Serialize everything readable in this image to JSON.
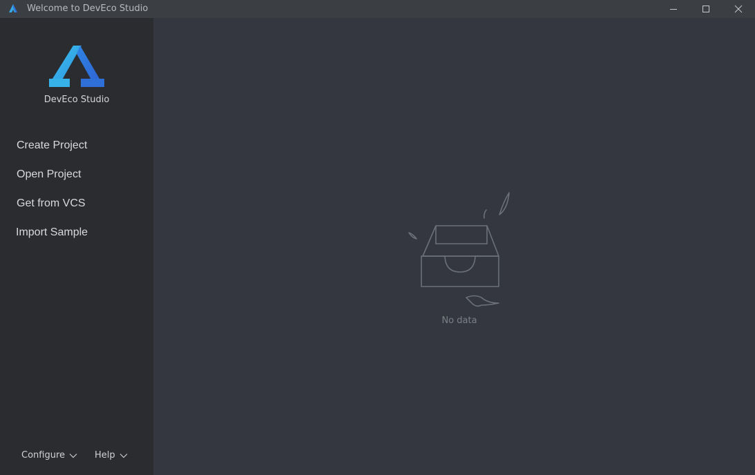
{
  "window": {
    "title": "Welcome to DevEco Studio"
  },
  "sidebar": {
    "app_name": "DevEco Studio",
    "menu": [
      {
        "label": "Create Project"
      },
      {
        "label": "Open Project"
      },
      {
        "label": "Get from VCS"
      },
      {
        "label": "Import Sample"
      }
    ],
    "footer": {
      "configure_label": "Configure",
      "help_label": "Help"
    }
  },
  "main": {
    "empty_text": "No data"
  },
  "colors": {
    "titlebar": "#3b3e43",
    "sidebar": "#2a2c30",
    "main": "#343740",
    "logo_light": "#38b6e8",
    "logo_dark": "#2f6fd6"
  }
}
